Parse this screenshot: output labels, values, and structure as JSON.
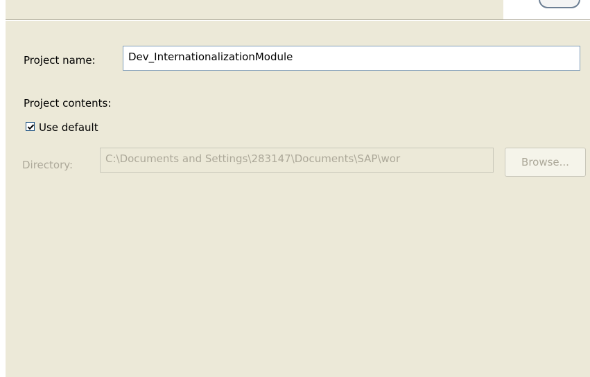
{
  "form": {
    "project_name_label": "Project name:",
    "project_name_value": "Dev_InternationalizationModule",
    "project_contents_label": "Project contents:",
    "use_default_label": "Use default",
    "use_default_checked": true,
    "directory_label": "Directory:",
    "directory_value": "C:\\Documents and Settings\\283147\\Documents\\SAP\\wor",
    "browse_label": "Browse..."
  }
}
